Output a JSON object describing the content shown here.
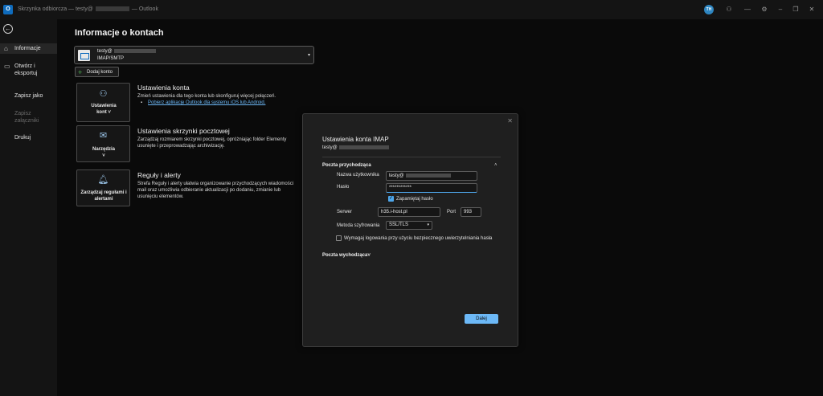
{
  "titlebar": {
    "app_icon": "outlook-icon",
    "title_prefix": "Skrzynka odbiorcza — testy@",
    "title_suffix": "— Outlook",
    "avatar_initials": "TH"
  },
  "sidebar": {
    "back_icon": "back-arrow-icon",
    "items": [
      {
        "label": "Informacje",
        "icon": "home-icon",
        "active": true
      },
      {
        "label": "Otwórz i eksportuj",
        "icon": "folder-open-icon",
        "active": false
      },
      {
        "label": "Zapisz jako",
        "active": false
      },
      {
        "label": "Zapisz załączniki",
        "active": false,
        "disabled": true
      },
      {
        "label": "Drukuj",
        "active": false
      }
    ]
  },
  "main": {
    "title": "Informacje o kontach",
    "account": {
      "email": "testy@",
      "type": "IMAP/SMTP"
    },
    "add_account": "Dodaj konto",
    "sections": [
      {
        "tile_label": "Ustawienia kont ˅",
        "tile_icon": "account-settings-icon",
        "title": "Ustawienia konta",
        "desc": "Zmień ustawienia dla tego konta lub skonfiguruj więcej połączeń.",
        "link": "Pobierz aplikację Outlook dla systemu iOS lub Android."
      },
      {
        "tile_label": "Narzędzia ˅",
        "tile_icon": "tools-icon",
        "title": "Ustawienia skrzynki pocztowej",
        "desc": "Zarządzaj rozmiarem skrzynki pocztowej, opróżniając folder Elementy usunięte i przeprowadzając archiwizację."
      },
      {
        "tile_label": "Zarządzaj regułami i alertami",
        "tile_icon": "bell-rules-icon",
        "title": "Reguły i alerty",
        "desc": "Strefa Reguły i alerty ułatwia organizowanie przychodzących wiadomości mail oraz umożliwia odbieranie aktualizacji po dodaniu, zmianie lub usunięciu elementów."
      }
    ]
  },
  "dialog": {
    "title": "Ustawienia konta IMAP",
    "email": "testy@",
    "incoming_header": "Poczta przychodząca",
    "username_label": "Nazwa użytkownika",
    "username_value": "testy@",
    "password_label": "Hasło",
    "password_value": "************",
    "remember_password": "Zapamiętaj hasło",
    "server_label": "Serwer",
    "server_value": "h35.i-host.pl",
    "port_label": "Port",
    "port_value": "993",
    "encryption_label": "Metoda szyfrowania",
    "encryption_value": "SSL/TLS",
    "spa_label": "Wymagaj logowania przy użyciu bezpiecznego uwierzytelniania hasła",
    "outgoing_header": "Poczta wychodząca",
    "next_button": "Dalej"
  },
  "colors": {
    "accent": "#6cb8f6",
    "annotation_arrow": "#e020e0"
  }
}
